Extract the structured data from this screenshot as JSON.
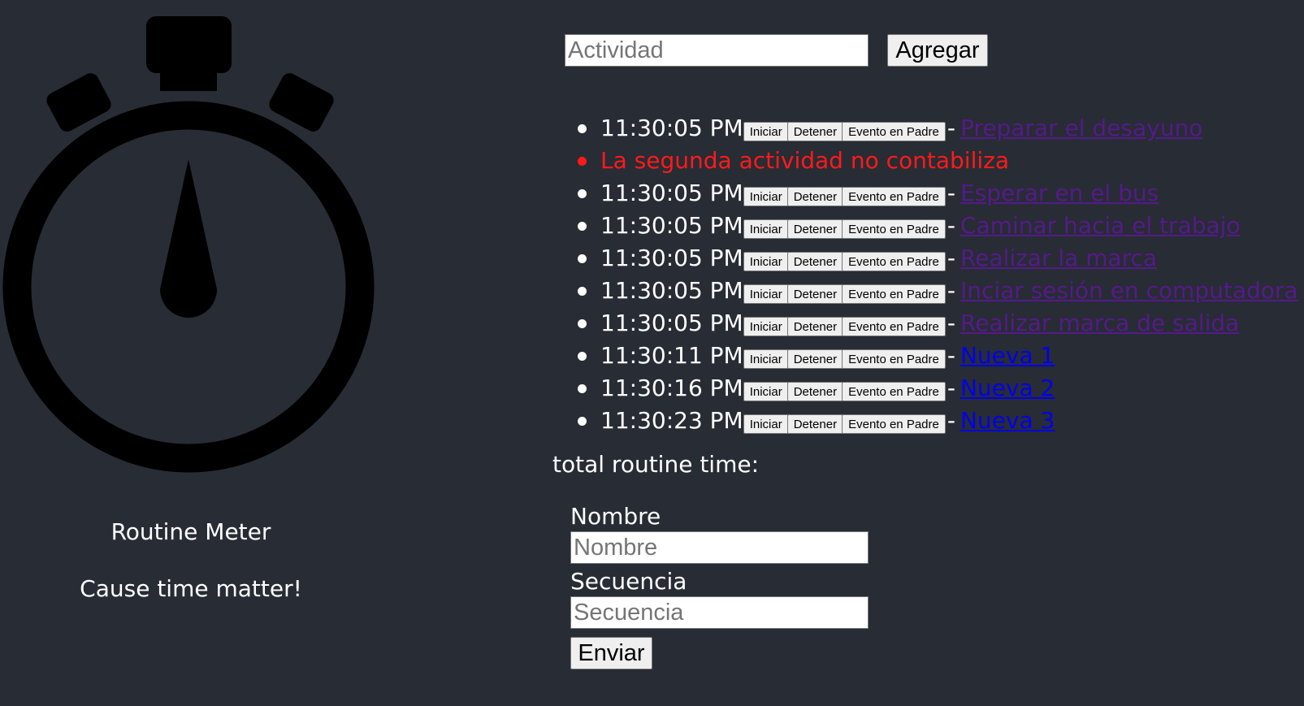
{
  "brand": {
    "title": "Routine Meter",
    "subtitle": "Cause time matter!"
  },
  "add_form": {
    "activity_placeholder": "Actividad",
    "add_label": "Agregar"
  },
  "buttons": {
    "start": "Iniciar",
    "stop": "Detener",
    "parent_event": "Evento en Padre",
    "separator": "-"
  },
  "activities": [
    {
      "time": "11:30:05 PM",
      "name": "Preparar el desayuno",
      "visited": true
    },
    {
      "note": "La segunda actividad no contabiliza"
    },
    {
      "time": "11:30:05 PM",
      "name": "Esperar en el bus",
      "visited": true
    },
    {
      "time": "11:30:05 PM",
      "name": "Caminar hacia el trabajo",
      "visited": true
    },
    {
      "time": "11:30:05 PM",
      "name": "Realizar la marca",
      "visited": true
    },
    {
      "time": "11:30:05 PM",
      "name": "Inciar sesión en computadora",
      "visited": true
    },
    {
      "time": "11:30:05 PM",
      "name": "Realizar marca de salida",
      "visited": true
    },
    {
      "time": "11:30:11 PM",
      "name": "Nueva 1",
      "visited": false
    },
    {
      "time": "11:30:16 PM",
      "name": "Nueva 2",
      "visited": false
    },
    {
      "time": "11:30:23 PM",
      "name": "Nueva 3",
      "visited": false
    }
  ],
  "total": {
    "label": "total routine time:"
  },
  "routine_form": {
    "name_label": "Nombre",
    "name_placeholder": "Nombre",
    "sequence_label": "Secuencia",
    "sequence_placeholder": "Secuencia",
    "submit_label": "Enviar"
  },
  "colors": {
    "background": "#282c34",
    "text": "#ffffff",
    "note": "#ff1a1a",
    "link_visited": "#551a8b",
    "link_unvisited": "#0000ee"
  },
  "icons": {
    "logo": "stopwatch-icon"
  }
}
